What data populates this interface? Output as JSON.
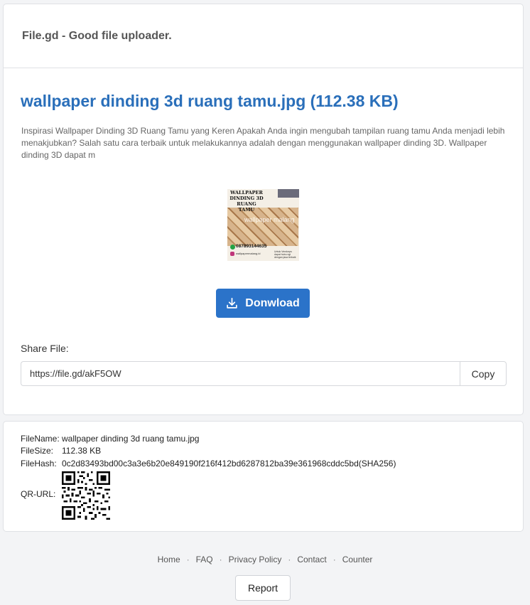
{
  "brand": "File.gd - Good file uploader.",
  "file": {
    "title": "wallpaper dinding 3d ruang tamu.jpg (112.38 KB)",
    "description": "Inspirasi Wallpaper Dinding 3D Ruang Tamu yang Keren Apakah Anda ingin mengubah tampilan ruang tamu Anda menjadi lebih menakjubkan? Salah satu cara terbaik untuk melakukannya adalah dengan menggunakan wallpaper dinding 3D. Wallpaper dinding 3D dapat m"
  },
  "thumbnail": {
    "title_line1": "WALLPAPER",
    "title_line2": "DINDING 3D",
    "title_line3": "RUANG TAMU",
    "watermark": "wallpaper malang",
    "phone": "087893144635",
    "ig_handle": "wallpapermalang.id",
    "note": "Untuk Vendorps dapat hubu ngi dengan jasa terbaik"
  },
  "download": {
    "label": "Donwload",
    "icon": "download-icon"
  },
  "share": {
    "label": "Share File:",
    "url": "https://file.gd/akF5OW",
    "copy_label": "Copy"
  },
  "info": {
    "filename_key": "FileName:",
    "filename_val": "wallpaper dinding 3d ruang tamu.jpg",
    "filesize_key": "FileSize:",
    "filesize_val": "112.38 KB",
    "filehash_key": "FileHash:",
    "filehash_val": "0c2d83493bd00c3a3e6b20e849190f216f412bd6287812ba39e361968cddc5bd(SHA256)",
    "qr_key": "QR-URL:"
  },
  "footer": {
    "links": [
      "Home",
      "FAQ",
      "Privacy Policy",
      "Contact",
      "Counter"
    ],
    "separator": "·",
    "report_label": "Report"
  },
  "colors": {
    "accent": "#2b73c9",
    "title": "#2a6fba"
  }
}
